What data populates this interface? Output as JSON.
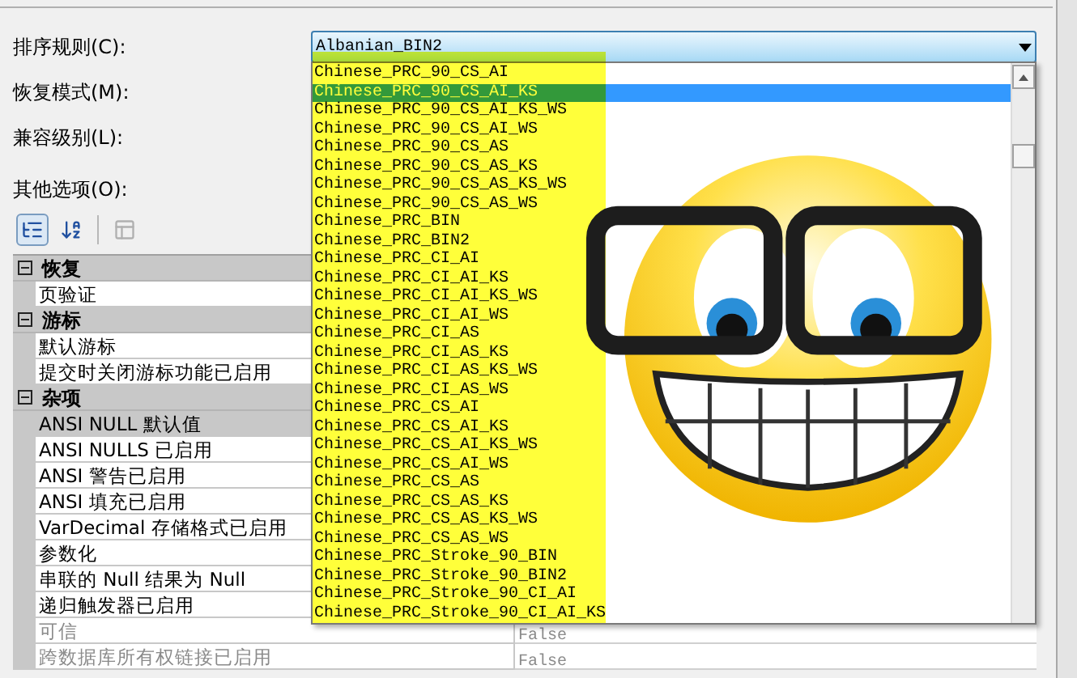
{
  "collation": {
    "label": "排序规则(C):",
    "value": "Albanian_BIN2",
    "options": [
      {
        "text": "Chinese_PRC_90_CS_AI",
        "selected": false
      },
      {
        "text": "Chinese_PRC_90_CS_AI_KS",
        "selected": true
      },
      {
        "text": "Chinese_PRC_90_CS_AI_KS_WS",
        "selected": false
      },
      {
        "text": "Chinese_PRC_90_CS_AI_WS",
        "selected": false
      },
      {
        "text": "Chinese_PRC_90_CS_AS",
        "selected": false
      },
      {
        "text": "Chinese_PRC_90_CS_AS_KS",
        "selected": false
      },
      {
        "text": "Chinese_PRC_90_CS_AS_KS_WS",
        "selected": false
      },
      {
        "text": "Chinese_PRC_90_CS_AS_WS",
        "selected": false
      },
      {
        "text": "Chinese_PRC_BIN",
        "selected": false
      },
      {
        "text": "Chinese_PRC_BIN2",
        "selected": false
      },
      {
        "text": "Chinese_PRC_CI_AI",
        "selected": false
      },
      {
        "text": "Chinese_PRC_CI_AI_KS",
        "selected": false
      },
      {
        "text": "Chinese_PRC_CI_AI_KS_WS",
        "selected": false
      },
      {
        "text": "Chinese_PRC_CI_AI_WS",
        "selected": false
      },
      {
        "text": "Chinese_PRC_CI_AS",
        "selected": false
      },
      {
        "text": "Chinese_PRC_CI_AS_KS",
        "selected": false
      },
      {
        "text": "Chinese_PRC_CI_AS_KS_WS",
        "selected": false
      },
      {
        "text": "Chinese_PRC_CI_AS_WS",
        "selected": false
      },
      {
        "text": "Chinese_PRC_CS_AI",
        "selected": false
      },
      {
        "text": "Chinese_PRC_CS_AI_KS",
        "selected": false
      },
      {
        "text": "Chinese_PRC_CS_AI_KS_WS",
        "selected": false
      },
      {
        "text": "Chinese_PRC_CS_AI_WS",
        "selected": false
      },
      {
        "text": "Chinese_PRC_CS_AS",
        "selected": false
      },
      {
        "text": "Chinese_PRC_CS_AS_KS",
        "selected": false
      },
      {
        "text": "Chinese_PRC_CS_AS_KS_WS",
        "selected": false
      },
      {
        "text": "Chinese_PRC_CS_AS_WS",
        "selected": false
      },
      {
        "text": "Chinese_PRC_Stroke_90_BIN",
        "selected": false
      },
      {
        "text": "Chinese_PRC_Stroke_90_BIN2",
        "selected": false
      },
      {
        "text": "Chinese_PRC_Stroke_90_CI_AI",
        "selected": false
      },
      {
        "text": "Chinese_PRC_Stroke_90_CI_AI_KS",
        "selected": false
      }
    ]
  },
  "other_labels": [
    "恢复模式(M):",
    "兼容级别(L):"
  ],
  "options_label": "其他选项(O):",
  "toolbar": [
    {
      "kind": "categorized",
      "pressed": true,
      "disabled": false
    },
    {
      "kind": "alphabetical",
      "pressed": false,
      "disabled": false
    },
    {
      "kind": "property_pages",
      "pressed": false,
      "disabled": true
    }
  ],
  "categories": [
    {
      "name": "恢复",
      "expanded": true,
      "children": [
        {
          "name": "页验证",
          "selected": false,
          "disabled": false
        }
      ]
    },
    {
      "name": "游标",
      "expanded": true,
      "children": [
        {
          "name": "默认游标",
          "selected": false,
          "disabled": false
        },
        {
          "name": "提交时关闭游标功能已启用",
          "selected": false,
          "disabled": false
        }
      ]
    },
    {
      "name": "杂项",
      "expanded": true,
      "children": [
        {
          "name": "ANSI NULL 默认值",
          "selected": true,
          "disabled": false
        },
        {
          "name": "ANSI NULLS 已启用",
          "selected": false,
          "disabled": false
        },
        {
          "name": "ANSI 警告已启用",
          "selected": false,
          "disabled": false
        },
        {
          "name": "ANSI 填充已启用",
          "selected": false,
          "disabled": false
        },
        {
          "name": "VarDecimal 存储格式已启用",
          "selected": false,
          "disabled": false
        },
        {
          "name": "参数化",
          "selected": false,
          "disabled": false
        },
        {
          "name": "串联的 Null 结果为 Null",
          "selected": false,
          "disabled": false
        },
        {
          "name": "递归触发器已启用",
          "selected": false,
          "disabled": false
        },
        {
          "name": "可信",
          "value": "False",
          "selected": false,
          "disabled": true
        },
        {
          "name": "跨数据库所有权链接已启用",
          "value": "False",
          "selected": false,
          "disabled": true
        }
      ]
    }
  ]
}
